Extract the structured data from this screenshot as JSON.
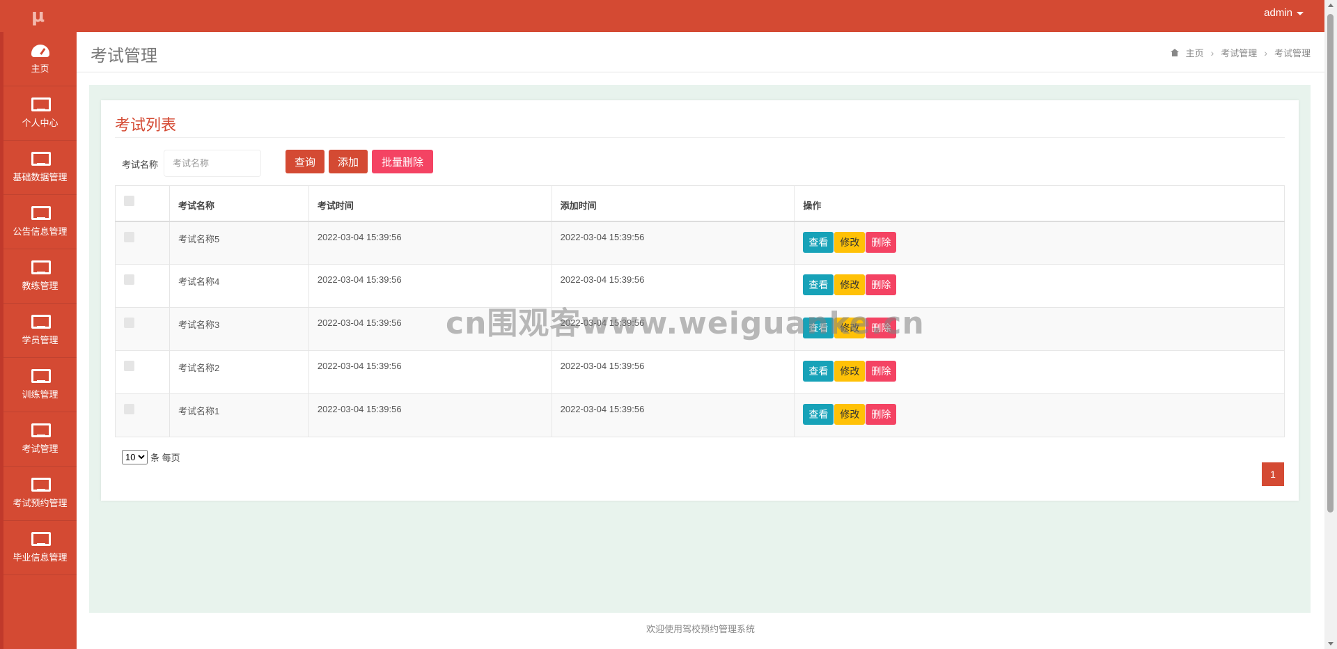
{
  "app": {
    "logo_text": "μ",
    "user": "admin"
  },
  "sidebar": {
    "items": [
      {
        "label": "主页",
        "icon": "dashboard-icon"
      },
      {
        "label": "个人中心",
        "icon": "monitor-icon"
      },
      {
        "label": "基础数据管理",
        "icon": "monitor-icon"
      },
      {
        "label": "公告信息管理",
        "icon": "monitor-icon"
      },
      {
        "label": "教练管理",
        "icon": "monitor-icon"
      },
      {
        "label": "学员管理",
        "icon": "monitor-icon"
      },
      {
        "label": "训练管理",
        "icon": "monitor-icon"
      },
      {
        "label": "考试管理",
        "icon": "monitor-icon"
      },
      {
        "label": "考试预约管理",
        "icon": "monitor-icon"
      },
      {
        "label": "毕业信息管理",
        "icon": "monitor-icon"
      }
    ]
  },
  "header": {
    "title": "考试管理",
    "breadcrumb": [
      "主页",
      "考试管理",
      "考试管理"
    ]
  },
  "card": {
    "title": "考试列表",
    "search": {
      "label": "考试名称",
      "placeholder": "考试名称",
      "value": ""
    },
    "buttons": {
      "query": "查询",
      "add": "添加",
      "batch_delete": "批量删除"
    },
    "table": {
      "columns": [
        "考试名称",
        "考试时间",
        "添加时间",
        "操作"
      ],
      "rows": [
        {
          "name": "考试名称5",
          "exam_time": "2022-03-04 15:39:56",
          "added_time": "2022-03-04 15:39:56"
        },
        {
          "name": "考试名称4",
          "exam_time": "2022-03-04 15:39:56",
          "added_time": "2022-03-04 15:39:56"
        },
        {
          "name": "考试名称3",
          "exam_time": "2022-03-04 15:39:56",
          "added_time": "2022-03-04 15:39:56"
        },
        {
          "name": "考试名称2",
          "exam_time": "2022-03-04 15:39:56",
          "added_time": "2022-03-04 15:39:56"
        },
        {
          "name": "考试名称1",
          "exam_time": "2022-03-04 15:39:56",
          "added_time": "2022-03-04 15:39:56"
        }
      ],
      "actions": {
        "view": "查看",
        "edit": "修改",
        "delete": "删除"
      }
    },
    "pagination": {
      "page_size": "10",
      "page_size_options": [
        "10"
      ],
      "page_size_suffix": "条 每页",
      "current_page": "1"
    }
  },
  "footer": {
    "text": "欢迎使用驾校预约管理系统"
  },
  "watermark": {
    "text": "cn围观客www.weiguanke.cn"
  },
  "colors": {
    "brand": "#d44a33",
    "view": "#17a2b8",
    "edit": "#ffc107",
    "delete": "#f44363",
    "content_bg": "#e8f3ed"
  }
}
